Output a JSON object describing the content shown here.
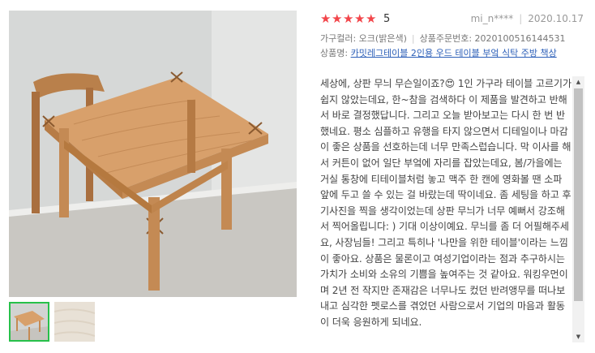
{
  "review": {
    "stars": [
      "★",
      "★",
      "★",
      "★",
      "★"
    ],
    "score": "5",
    "author": "mi_n****",
    "date": "2020.10.17",
    "color_label": "가구컬러: 오크(밝은색)",
    "order_label": "상품주문번호: 2020100516144531",
    "product_prefix": "상품명:",
    "product_name": "카밋레그테이블 2인용 우드 테이블 부엌 식탁 주방 책상",
    "body": "세상에, 상판 무늬 무슨일이죠?😍 1인 가구라 테이블 고르기가 쉽지 않았는데요, 한~참을 검색하다 이 제품을 발견하고 반해서 바로 결정했답니다. 그리고 오늘 받아보고는 다시 한 번 반했네요. 평소 심플하고 유행을 타지 않으면서 디테일이나 마감이 좋은 상품을 선호하는데 너무 만족스럽습니다. 막 이사를 해서 커튼이 없어 일단 부엌에 자리를 잡았는데요, 봄/가을에는 거실 통창에 티테이블처럼 놓고 맥주 한 캔에 영화볼 땐 소파 앞에 두고 쓸 수 있는 걸 바랐는데 딱이네요. 좀 세팅을 하고 후기사진을 찍을 생각이었는데 상판 무늬가 너무 예뻐서 강조해서 찍어올립니다: ) 기대 이상이예요. 무늬를 좀 더 어필해주세요, 사장님들! 그리고 특히나 '나만을 위한 테이블'이라는 느낌이 좋아요. 상품은 물론이고 여성기업이라는 점과 추구하시는 가치가 소비와 소유의 기쁨을 높여주는 것 같아요. 워킹우먼이며 2년 전 작지만 존재감은 너무나도 컸던 반려앵무를 떠나보내고 심각한 펫로스를 겪었던 사람으로서 기업의 마음과 활동이 더욱 응원하게 되네요."
  },
  "gallery": {
    "main_image": "wooden-table-photo",
    "thumbnails": [
      "table-thumbnail",
      "tabletop-texture-thumbnail"
    ]
  },
  "colors": {
    "star": "#f2454a",
    "link": "#2c5fb8",
    "thumb_active": "#27c04a"
  }
}
